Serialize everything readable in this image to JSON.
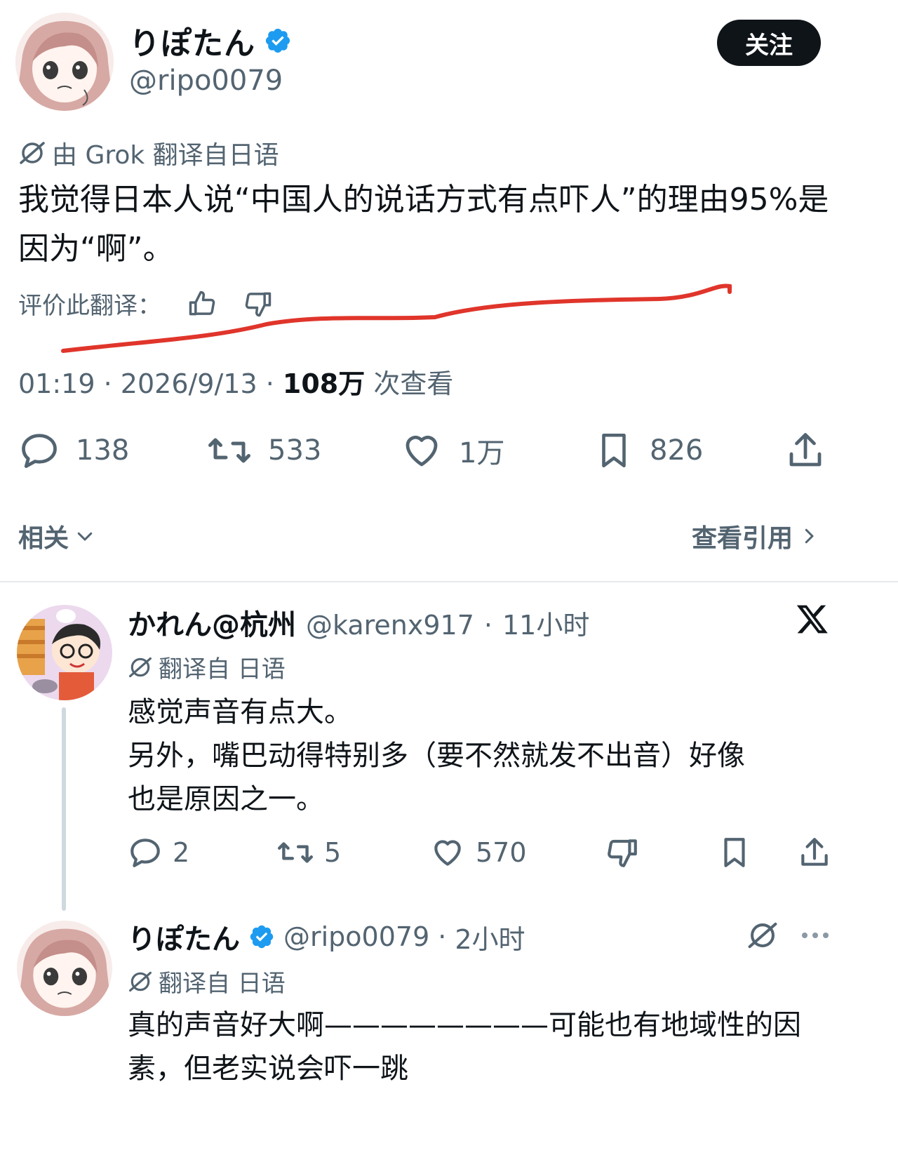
{
  "main_tweet": {
    "display_name": "りぽたん",
    "handle": "@ripo0079",
    "follow_label": "关注",
    "translation_note": "由 Grok 翻译自日语",
    "text": "我觉得日本人说“中国人的说话方式有点吓人”的理由95%是因为“啊”。",
    "rate_label": "评价此翻译：",
    "time": "01:19",
    "date": "2026/9/13",
    "views_count": "108万",
    "views_label": "次查看",
    "sep": "·",
    "stats": {
      "replies": "138",
      "retweets": "533",
      "likes": "1万",
      "bookmarks": "826"
    },
    "related_label": "相关",
    "quotes_label": "查看引用"
  },
  "replies": [
    {
      "display_name": "かれん@杭州",
      "handle": "@karenx917",
      "time": "11小时",
      "translation_note": "翻译自 日语",
      "text_lines": [
        "感觉声音有点大。",
        "另外，嘴巴动得特别多（要不然就发不出音）好像",
        "也是原因之一。"
      ],
      "stats": {
        "replies": "2",
        "retweets": "5",
        "likes": "570"
      }
    },
    {
      "display_name": "りぽたん",
      "handle": "@ripo0079",
      "time": "2小时",
      "translation_note": "翻译自 日语",
      "text_lines": [
        "真的声音好大啊————————可能也有地域性的因",
        "素，但老实说会吓一跳"
      ]
    }
  ],
  "colors": {
    "verified": "#1d9bf0",
    "annotation_red": "#e0352b",
    "text_primary": "#0f1419",
    "text_secondary": "#536471"
  },
  "icons": [
    "verified-badge-icon",
    "translate-icon",
    "thumbs-up-icon",
    "thumbs-down-icon",
    "reply-icon",
    "retweet-icon",
    "like-icon",
    "bookmark-icon",
    "share-icon",
    "chevron-down-icon",
    "chevron-right-icon",
    "x-logo-icon",
    "more-icon"
  ]
}
